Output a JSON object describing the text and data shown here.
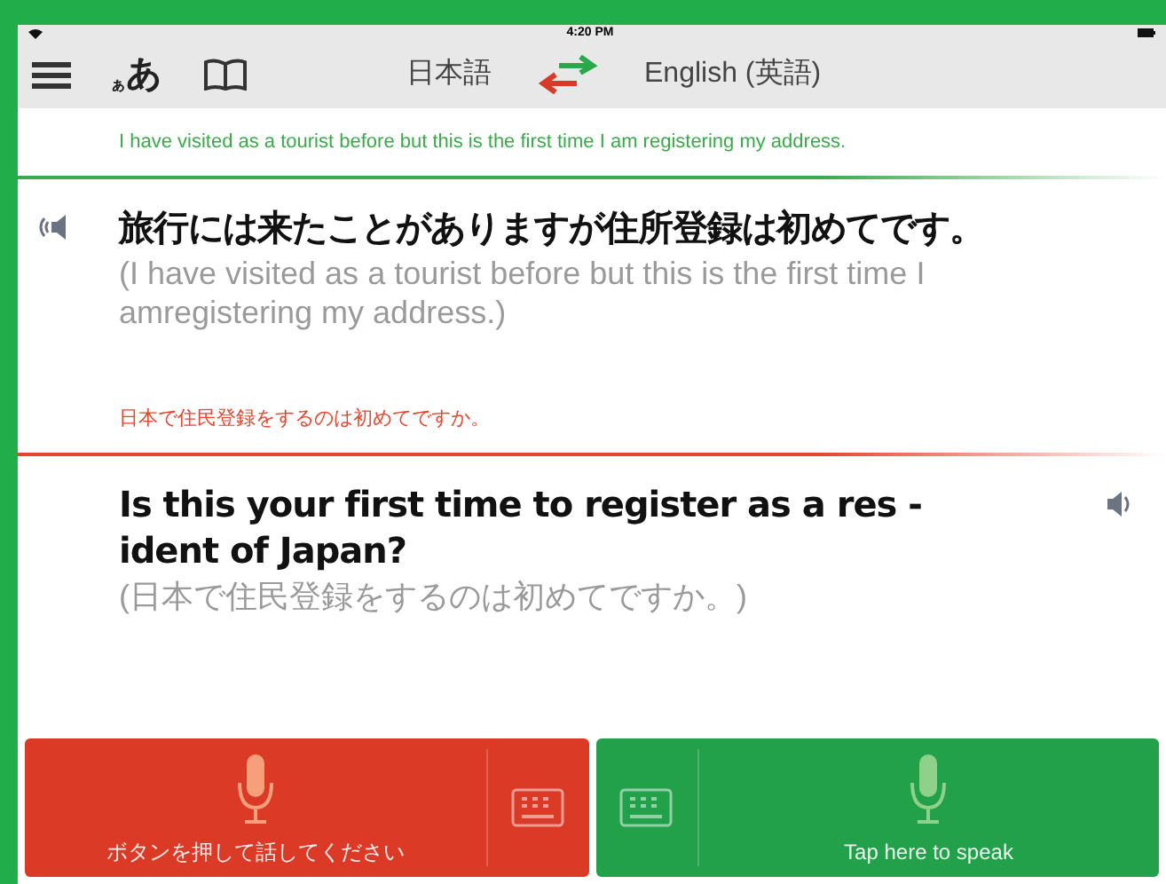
{
  "status_bar": {
    "time": "4:20 PM"
  },
  "toolbar": {
    "font_button": "あ",
    "font_button_small": "ぁ",
    "source_language": "日本語",
    "target_language": "English (英語)"
  },
  "messages": [
    {
      "kind": "left",
      "color": "#3aaa4a",
      "back_translation": "I have visited as a tourist before but this is the first time I am registering my address.",
      "text": "旅行には来たことがありますが住所登録は初めてです。",
      "translation": "(I have visited as a tourist before but this is the first time I amregistering my address.)"
    },
    {
      "kind": "right",
      "color": "#e8452e",
      "back_translation": "日本で住民登録をするのは初めてですか。",
      "text": "Is this your first time to register as a res -ident of Japan?",
      "translation": "(日本で住民登録をするのは初めてですか。)"
    }
  ],
  "buttons": [
    {
      "kind": "left",
      "color": "#da3a26",
      "label": "ボタンを押して話してください"
    },
    {
      "kind": "right",
      "color": "#22a04a",
      "label": "Tap here to speak"
    }
  ]
}
